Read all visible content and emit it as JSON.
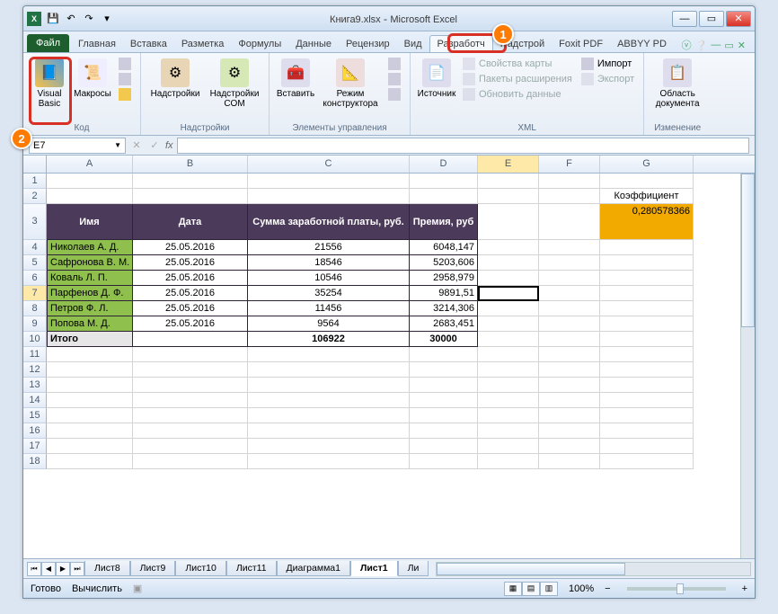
{
  "callouts": {
    "one": "1",
    "two": "2"
  },
  "titlebar": {
    "filename": "Книга9.xlsx",
    "app": "Microsoft Excel"
  },
  "qat": {
    "save": "💾",
    "undo": "↶",
    "redo": "↷"
  },
  "tabs": {
    "file": "Файл",
    "items": [
      "Главная",
      "Вставка",
      "Разметка",
      "Формулы",
      "Данные",
      "Рецензир",
      "Вид",
      "Разработч",
      "Надстрой",
      "Foxit PDF",
      "ABBYY PD"
    ],
    "active_index": 7
  },
  "ribbon": {
    "code_group": {
      "label": "Код",
      "visual_basic": "Visual\nBasic",
      "macros": "Макросы",
      "extra1": "⏺",
      "extra2": "⬚",
      "extra3": "⚠"
    },
    "addins_group": {
      "label": "Надстройки",
      "addins": "Надстройки",
      "com": "Надстройки\nCOM"
    },
    "controls_group": {
      "label": "Элементы управления",
      "insert": "Вставить",
      "design": "Режим\nконструктора",
      "extra1": "□",
      "extra2": "✎",
      "extra3": "▣"
    },
    "xml_group": {
      "label": "XML",
      "source": "Источник",
      "map_props": "Свойства карты",
      "exp_packs": "Пакеты расширения",
      "refresh": "Обновить данные",
      "import": "Импорт",
      "export": "Экспорт"
    },
    "modify_group": {
      "label": "Изменение",
      "doc_area": "Область\nдокумента"
    }
  },
  "namebox": "E7",
  "fx": "fx",
  "columns": [
    "A",
    "B",
    "C",
    "D",
    "E",
    "F",
    "G"
  ],
  "sheet": {
    "header": {
      "name": "Имя",
      "date": "Дата",
      "salary": "Сумма заработной платы, руб.",
      "bonus": "Премия, руб"
    },
    "koef_label": "Коэффициент",
    "koef_value": "0,280578366",
    "rows": [
      {
        "name": "Николаев А. Д.",
        "date": "25.05.2016",
        "salary": "21556",
        "bonus": "6048,147"
      },
      {
        "name": "Сафронова В. М.",
        "date": "25.05.2016",
        "salary": "18546",
        "bonus": "5203,606"
      },
      {
        "name": "Коваль Л. П.",
        "date": "25.05.2016",
        "salary": "10546",
        "bonus": "2958,979"
      },
      {
        "name": "Парфенов Д. Ф.",
        "date": "25.05.2016",
        "salary": "35254",
        "bonus": "9891,51"
      },
      {
        "name": "Петров Ф. Л.",
        "date": "25.05.2016",
        "salary": "11456",
        "bonus": "3214,306"
      },
      {
        "name": "Попова М. Д.",
        "date": "25.05.2016",
        "salary": "9564",
        "bonus": "2683,451"
      }
    ],
    "total": {
      "name": "Итого",
      "salary": "106922",
      "bonus": "30000"
    }
  },
  "sheets": [
    "Лист8",
    "Лист9",
    "Лист10",
    "Лист11",
    "Диаграмма1",
    "Лист1",
    "Ли"
  ],
  "active_sheet_index": 5,
  "status": {
    "ready": "Готово",
    "calc": "Вычислить",
    "zoom": "100%"
  },
  "zoom_controls": {
    "minus": "−",
    "plus": "+"
  },
  "win": {
    "min": "—",
    "max": "▭",
    "close": "✕"
  },
  "help": {
    "q": "?",
    "chev": "▾",
    "min": "—",
    "rest": "▭",
    "x": "✕"
  }
}
